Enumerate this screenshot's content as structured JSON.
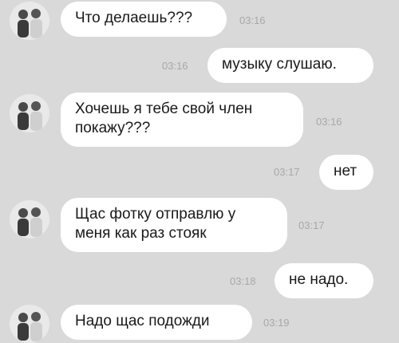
{
  "messages": [
    {
      "from": "them",
      "text": "Что делаешь???",
      "time": "03:16"
    },
    {
      "from": "me",
      "text": "музыку слушаю.",
      "time": "03:16"
    },
    {
      "from": "them",
      "text": "Хочешь я тебе свой член\nпокажу???",
      "time": "03:16"
    },
    {
      "from": "me",
      "text": "нет",
      "time": "03:17"
    },
    {
      "from": "them",
      "text": "Щас фотку отправлю у\nменя как раз стояк",
      "time": "03:17"
    },
    {
      "from": "me",
      "text": "не надо.",
      "time": "03:18"
    },
    {
      "from": "them",
      "text": "Надо щас подожди",
      "time": "03:19"
    }
  ],
  "colors": {
    "background": "#d9d9d9",
    "bubble": "#ffffff",
    "time_text": "#a8a8a8"
  }
}
